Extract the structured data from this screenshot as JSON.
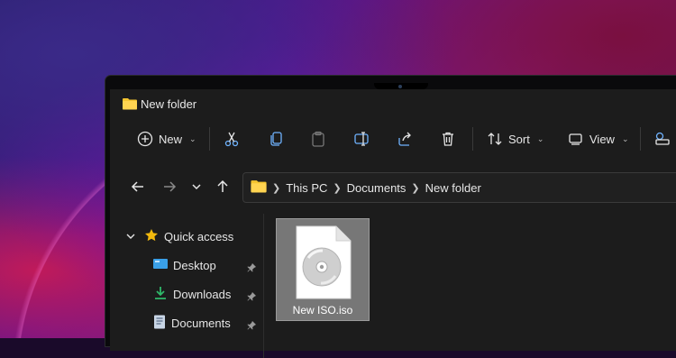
{
  "window": {
    "title": "New folder"
  },
  "toolbar": {
    "new_label": "New",
    "sort_label": "Sort",
    "view_label": "View"
  },
  "address": {
    "crumbs": [
      "This PC",
      "Documents",
      "New folder"
    ]
  },
  "sidebar": {
    "quick_access": "Quick access",
    "items": [
      {
        "label": "Desktop",
        "icon": "desktop-icon",
        "pinned": true
      },
      {
        "label": "Downloads",
        "icon": "downloads-icon",
        "pinned": true
      },
      {
        "label": "Documents",
        "icon": "documents-icon",
        "pinned": true
      }
    ]
  },
  "files": [
    {
      "name": "New ISO.iso",
      "icon": "disc-image-file-icon",
      "selected": true
    }
  ],
  "colors": {
    "folder": "#f4c430",
    "star": "#f2b90d",
    "desktop": "#3aa0e8",
    "downloads": "#2fb86a",
    "window_bg": "#1c1c1c",
    "selection": "#777777"
  }
}
